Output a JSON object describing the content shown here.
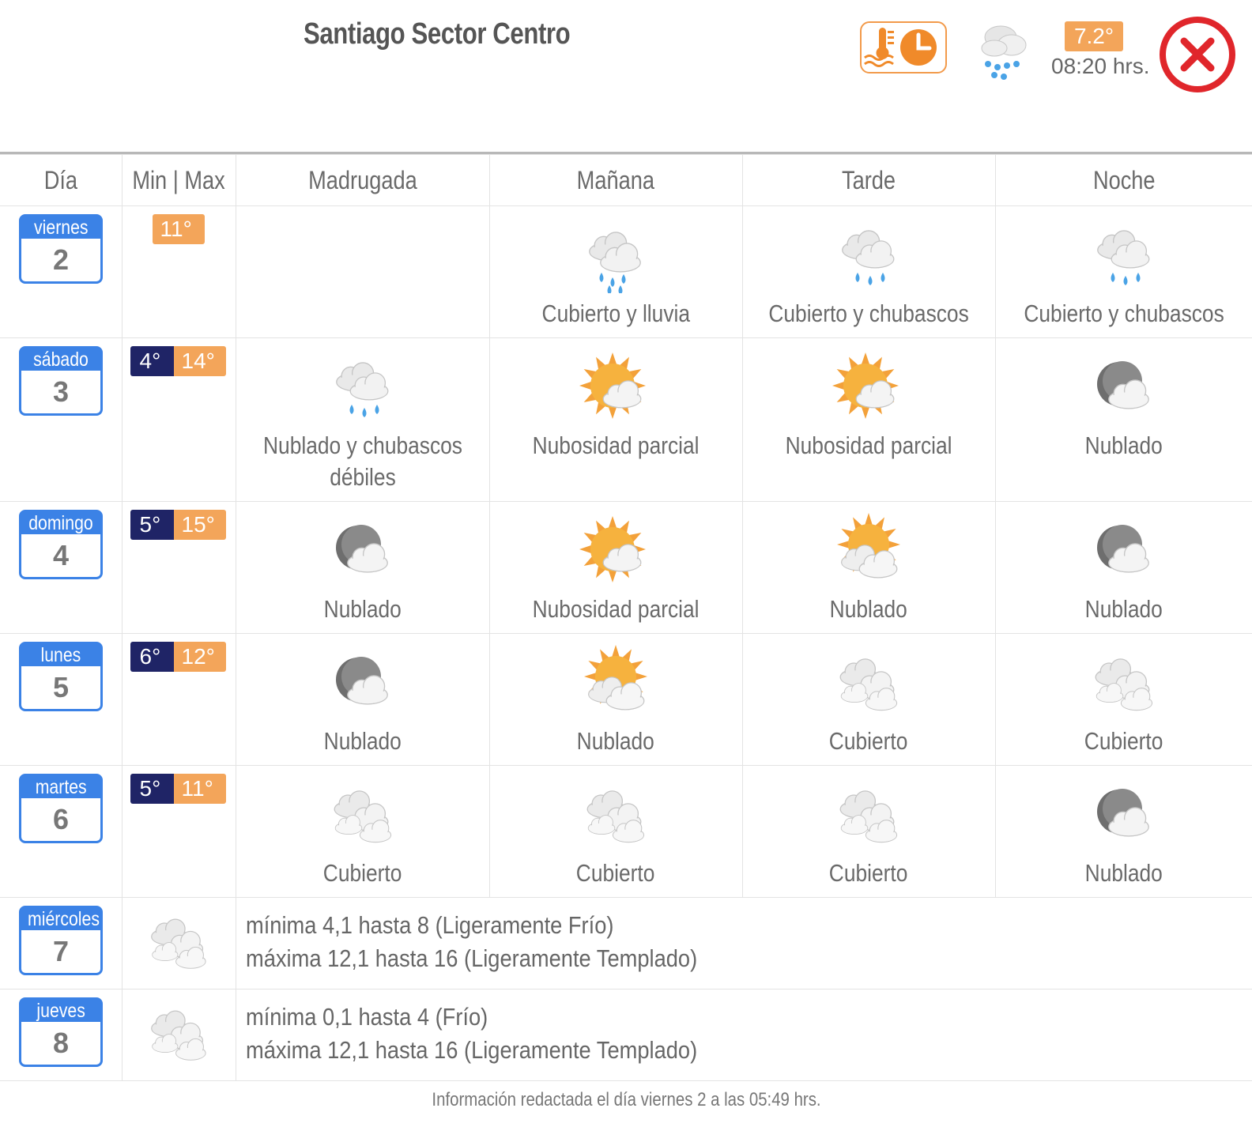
{
  "header": {
    "title": "Santiago Sector Centro",
    "current_temp": "7.2°",
    "current_time": "08:20 hrs.",
    "current_icon": "rain-cloud-icon"
  },
  "columns": [
    "Día",
    "Min | Max",
    "Madrugada",
    "Mañana",
    "Tarde",
    "Noche"
  ],
  "days": [
    {
      "dow": "viernes",
      "num": "2",
      "min": "",
      "max": "11°",
      "periods": [
        null,
        {
          "icon": "rain",
          "text": "Cubierto y lluvia"
        },
        {
          "icon": "showers",
          "text": "Cubierto y chubascos"
        },
        {
          "icon": "showers",
          "text": "Cubierto y chubascos"
        }
      ]
    },
    {
      "dow": "sábado",
      "num": "3",
      "min": "4°",
      "max": "14°",
      "periods": [
        {
          "icon": "showers",
          "text": "Nublado y chubascos débiles"
        },
        {
          "icon": "partly-sunny",
          "text": "Nubosidad parcial"
        },
        {
          "icon": "partly-sunny",
          "text": "Nubosidad parcial"
        },
        {
          "icon": "moon-cloud",
          "text": "Nublado"
        }
      ]
    },
    {
      "dow": "domingo",
      "num": "4",
      "min": "5°",
      "max": "15°",
      "periods": [
        {
          "icon": "moon-cloud",
          "text": "Nublado"
        },
        {
          "icon": "partly-sunny",
          "text": "Nubosidad parcial"
        },
        {
          "icon": "sun-clouds",
          "text": "Nublado"
        },
        {
          "icon": "moon-cloud",
          "text": "Nublado"
        }
      ]
    },
    {
      "dow": "lunes",
      "num": "5",
      "min": "6°",
      "max": "12°",
      "periods": [
        {
          "icon": "moon-cloud",
          "text": "Nublado"
        },
        {
          "icon": "sun-clouds",
          "text": "Nublado"
        },
        {
          "icon": "overcast",
          "text": "Cubierto"
        },
        {
          "icon": "overcast",
          "text": "Cubierto"
        }
      ]
    },
    {
      "dow": "martes",
      "num": "6",
      "min": "5°",
      "max": "11°",
      "periods": [
        {
          "icon": "overcast",
          "text": "Cubierto"
        },
        {
          "icon": "overcast",
          "text": "Cubierto"
        },
        {
          "icon": "overcast",
          "text": "Cubierto"
        },
        {
          "icon": "moon-cloud",
          "text": "Nublado"
        }
      ]
    }
  ],
  "extended": [
    {
      "dow": "miércoles",
      "num": "7",
      "icon": "overcast",
      "line1": "mínima 4,1 hasta 8 (Ligeramente Frío)",
      "line2": "máxima 12,1 hasta 16 (Ligeramente Templado)"
    },
    {
      "dow": "jueves",
      "num": "8",
      "icon": "overcast",
      "line1": "mínima 0,1 hasta 4 (Frío)",
      "line2": "máxima 12,1 hasta 16 (Ligeramente Templado)"
    }
  ],
  "footer": "Información redactada el día viernes 2 a las 05:49 hrs.",
  "colors": {
    "calendar": "#3b82e6",
    "min_bg": "#1f2466",
    "max_bg": "#f3a55a",
    "close": "#e0262b",
    "accent": "#f29a4a"
  }
}
